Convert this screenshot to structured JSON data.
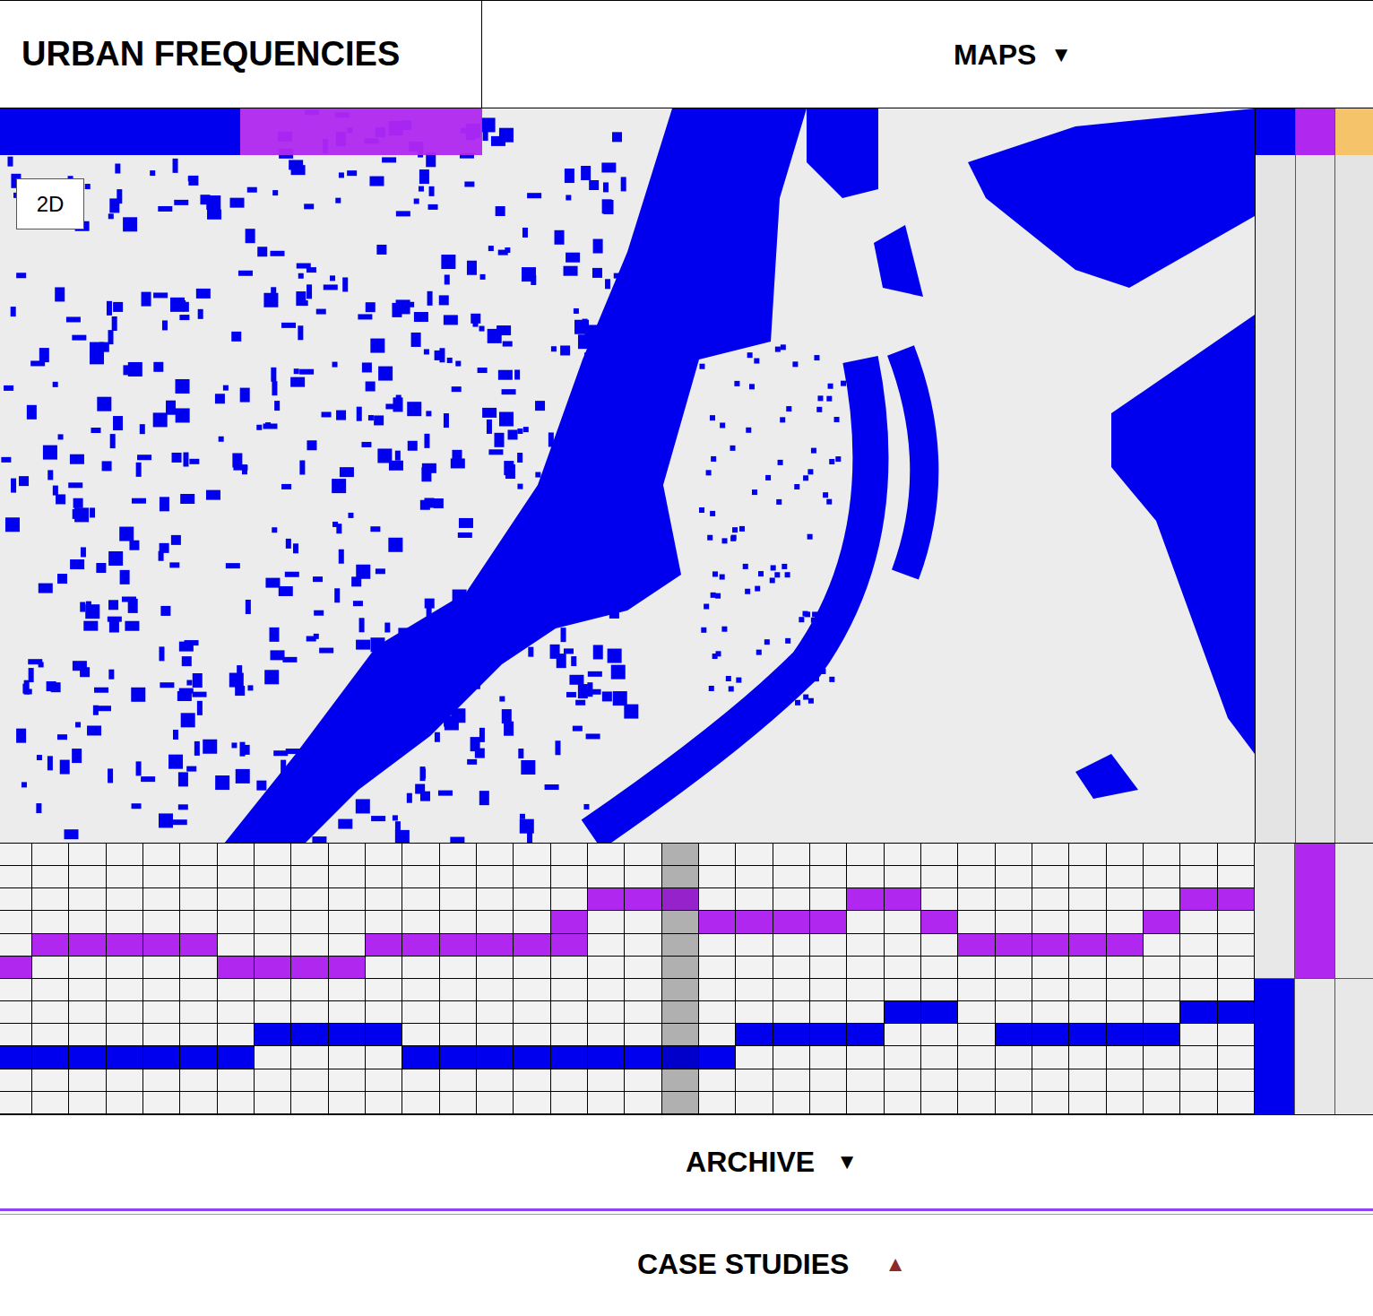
{
  "header": {
    "title": "URBAN FREQUENCIES",
    "nav": {
      "label": "MAPS",
      "icon": "▼"
    }
  },
  "layers": [
    {
      "color": "#0000ee",
      "selected": true
    },
    {
      "color": "#b028f0",
      "selected": false
    }
  ],
  "map": {
    "mode": "2D"
  },
  "channels": [
    {
      "color": "#0000ee"
    },
    {
      "color": "#b028f0"
    },
    {
      "color": "#f5c46a"
    }
  ],
  "steps": [
    {
      "selected": false
    },
    {
      "selected": false
    },
    {
      "selected": false
    },
    {
      "selected": false
    },
    {
      "selected": false
    },
    {
      "selected": false
    },
    {
      "selected": false
    },
    {
      "selected": false
    },
    {
      "selected": false
    },
    {
      "selected": false
    },
    {
      "selected": false
    },
    {
      "selected": false
    },
    {
      "selected": false
    },
    {
      "selected": false
    },
    {
      "selected": false
    },
    {
      "selected": false
    },
    {
      "selected": false
    },
    {
      "selected": false
    },
    {
      "selected": true
    },
    {
      "selected": false
    },
    {
      "selected": false
    },
    {
      "selected": false
    },
    {
      "selected": false
    },
    {
      "selected": false
    },
    {
      "selected": false
    },
    {
      "selected": false
    },
    {
      "selected": false
    },
    {
      "selected": false
    },
    {
      "selected": false
    },
    {
      "selected": false
    },
    {
      "selected": false
    },
    {
      "selected": false
    },
    {
      "selected": false
    },
    {
      "selected": false
    }
  ],
  "rows": [
    {
      "channel": 1,
      "cells": [
        0,
        0,
        0,
        0,
        0,
        0,
        0,
        0,
        0,
        0,
        0,
        0,
        0,
        0,
        0,
        0,
        0,
        0,
        0,
        0,
        0,
        0,
        0,
        0,
        0,
        0,
        0,
        0,
        0,
        0,
        0,
        0,
        0,
        0
      ]
    },
    {
      "channel": 1,
      "cells": [
        0,
        0,
        0,
        0,
        0,
        0,
        0,
        0,
        0,
        0,
        0,
        0,
        0,
        0,
        0,
        0,
        0,
        0,
        0,
        0,
        0,
        0,
        0,
        0,
        0,
        0,
        0,
        0,
        0,
        0,
        0,
        0,
        0,
        0
      ]
    },
    {
      "channel": 1,
      "cells": [
        0,
        0,
        0,
        0,
        0,
        0,
        0,
        0,
        0,
        0,
        0,
        0,
        0,
        0,
        0,
        0,
        1,
        1,
        1,
        0,
        0,
        0,
        0,
        1,
        1,
        0,
        0,
        0,
        0,
        0,
        0,
        0,
        1,
        1
      ]
    },
    {
      "channel": 1,
      "cells": [
        0,
        0,
        0,
        0,
        0,
        0,
        0,
        0,
        0,
        0,
        0,
        0,
        0,
        0,
        0,
        1,
        0,
        0,
        0,
        1,
        1,
        1,
        1,
        0,
        0,
        1,
        0,
        0,
        0,
        0,
        0,
        1,
        0,
        0
      ]
    },
    {
      "channel": 1,
      "cells": [
        0,
        1,
        1,
        1,
        1,
        1,
        0,
        0,
        0,
        0,
        1,
        1,
        1,
        1,
        1,
        1,
        0,
        0,
        0,
        0,
        0,
        0,
        0,
        0,
        0,
        0,
        1,
        1,
        1,
        1,
        1,
        0,
        0,
        0
      ]
    },
    {
      "channel": 1,
      "cells": [
        1,
        0,
        0,
        0,
        0,
        0,
        1,
        1,
        1,
        1,
        0,
        0,
        0,
        0,
        0,
        0,
        0,
        0,
        0,
        0,
        0,
        0,
        0,
        0,
        0,
        0,
        0,
        0,
        0,
        0,
        0,
        0,
        0,
        0
      ]
    },
    {
      "channel": 0,
      "cells": [
        0,
        0,
        0,
        0,
        0,
        0,
        0,
        0,
        0,
        0,
        0,
        0,
        0,
        0,
        0,
        0,
        0,
        0,
        0,
        0,
        0,
        0,
        0,
        0,
        0,
        0,
        0,
        0,
        0,
        0,
        0,
        0,
        0,
        0
      ]
    },
    {
      "channel": 0,
      "cells": [
        0,
        0,
        0,
        0,
        0,
        0,
        0,
        0,
        0,
        0,
        0,
        0,
        0,
        0,
        0,
        0,
        0,
        0,
        0,
        0,
        0,
        0,
        0,
        0,
        1,
        1,
        0,
        0,
        0,
        0,
        0,
        0,
        1,
        1
      ]
    },
    {
      "channel": 0,
      "cells": [
        0,
        0,
        0,
        0,
        0,
        0,
        0,
        1,
        1,
        1,
        1,
        0,
        0,
        0,
        0,
        0,
        0,
        0,
        0,
        0,
        1,
        1,
        1,
        1,
        0,
        0,
        0,
        1,
        1,
        1,
        1,
        1,
        0,
        0
      ]
    },
    {
      "channel": 0,
      "cells": [
        1,
        1,
        1,
        1,
        1,
        1,
        1,
        0,
        0,
        0,
        0,
        1,
        1,
        1,
        1,
        1,
        1,
        1,
        1,
        1,
        0,
        0,
        0,
        0,
        0,
        0,
        0,
        0,
        0,
        0,
        0,
        0,
        0,
        0
      ]
    },
    {
      "channel": 0,
      "cells": [
        0,
        0,
        0,
        0,
        0,
        0,
        0,
        0,
        0,
        0,
        0,
        0,
        0,
        0,
        0,
        0,
        0,
        0,
        0,
        0,
        0,
        0,
        0,
        0,
        0,
        0,
        0,
        0,
        0,
        0,
        0,
        0,
        0,
        0
      ]
    },
    {
      "channel": 0,
      "cells": [
        0,
        0,
        0,
        0,
        0,
        0,
        0,
        0,
        0,
        0,
        0,
        0,
        0,
        0,
        0,
        0,
        0,
        0,
        0,
        0,
        0,
        0,
        0,
        0,
        0,
        0,
        0,
        0,
        0,
        0,
        0,
        0,
        0,
        0
      ]
    }
  ],
  "sections": [
    {
      "label": "ARCHIVE",
      "icon": "▼",
      "color": "#000000"
    },
    {
      "label": "CASE STUDIES",
      "icon": "▲",
      "color": "#8b2a2a"
    }
  ]
}
